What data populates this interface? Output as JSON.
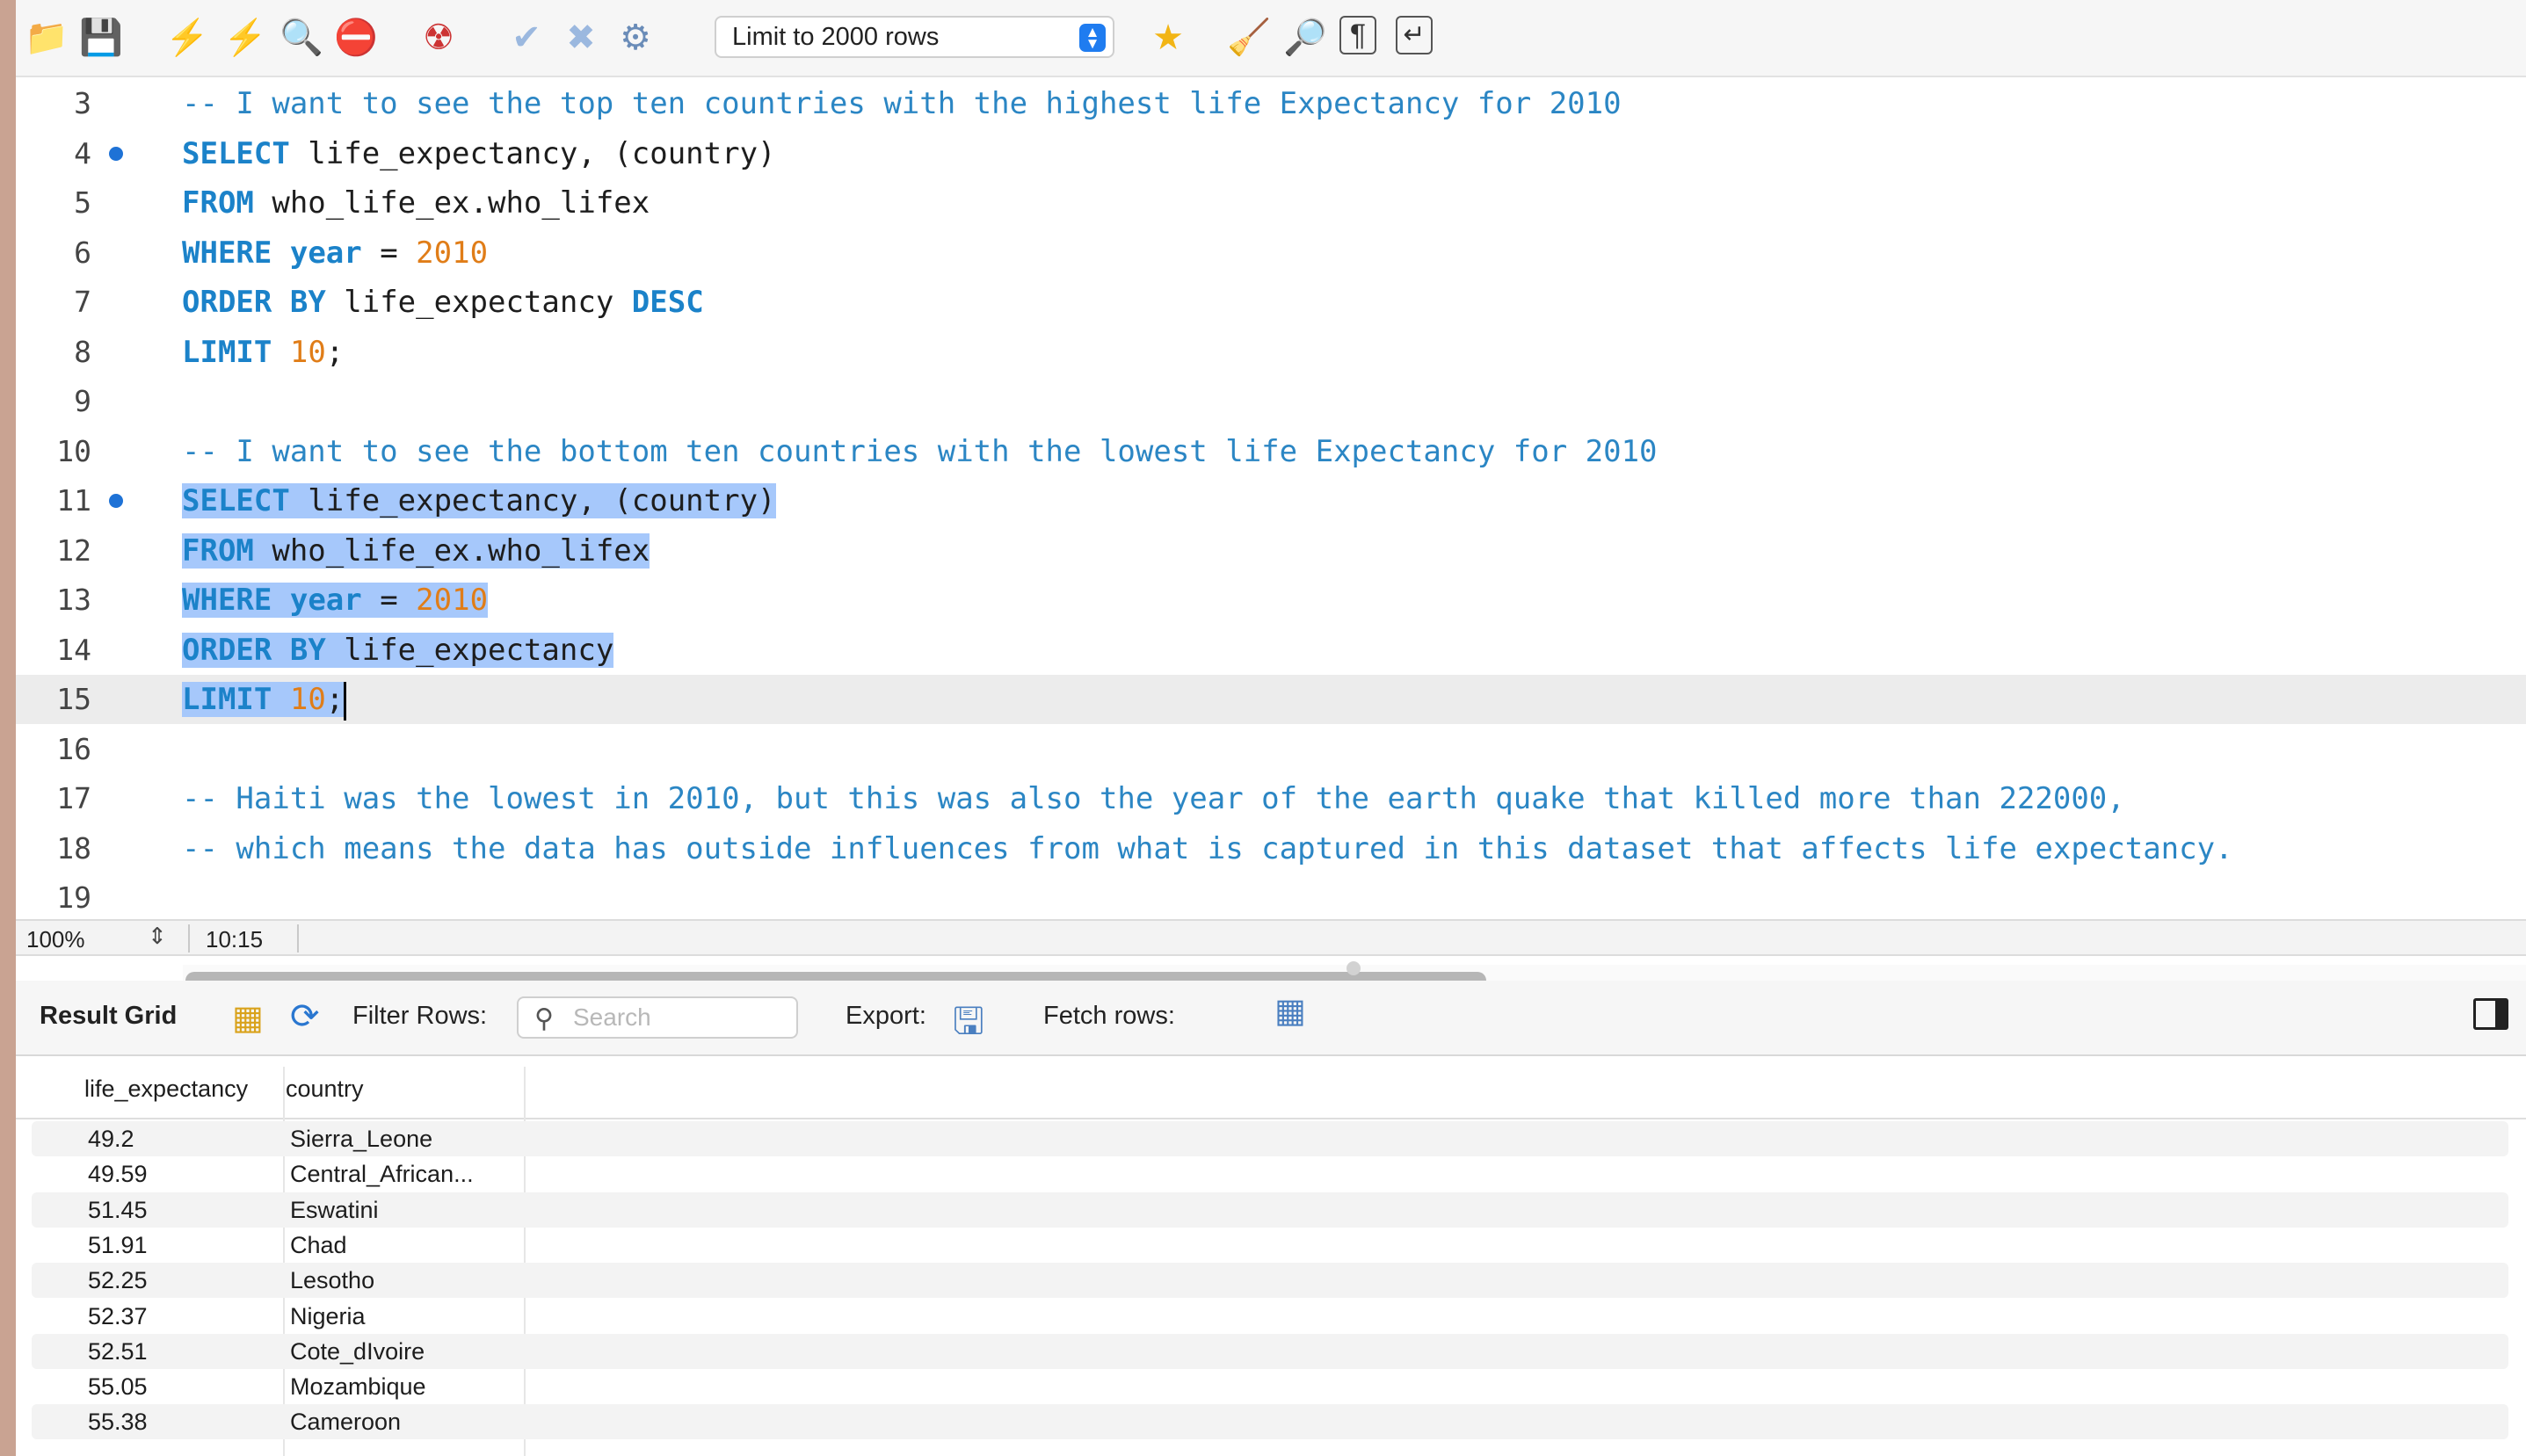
{
  "toolbar": {
    "icons": [
      "open-folder-icon",
      "save-icon",
      "execute-lightning-icon",
      "execute-current-lightning-icon",
      "explain-magnifier-icon",
      "stop-icon",
      "toggle-error-icon",
      "commit-check-icon",
      "rollback-x-icon",
      "autocommit-icon",
      "bookmark-star-icon",
      "beautify-broom-icon",
      "find-magnifier-icon",
      "invisible-chars-pilcrow-icon",
      "wrap-lines-icon"
    ],
    "limit_label": "Limit to 2000 rows"
  },
  "editor": {
    "lines": [
      {
        "n": "3",
        "text": "-- I want to see the top ten countries with the highest life Expectancy for 2010"
      },
      {
        "n": "4",
        "breakpoint": true,
        "text": "SELECT life_expectancy, (country)"
      },
      {
        "n": "5",
        "text": "FROM who_life_ex.who_lifex"
      },
      {
        "n": "6",
        "text": "WHERE year = 2010"
      },
      {
        "n": "7",
        "text": "ORDER BY life_expectancy DESC"
      },
      {
        "n": "8",
        "text": "LIMIT 10;"
      },
      {
        "n": "9",
        "text": ""
      },
      {
        "n": "10",
        "text": "-- I want to see the bottom ten countries with the lowest life Expectancy for 2010"
      },
      {
        "n": "11",
        "breakpoint": true,
        "selected": true,
        "text": "SELECT life_expectancy, (country)"
      },
      {
        "n": "12",
        "selected": true,
        "text": "FROM who_life_ex.who_lifex"
      },
      {
        "n": "13",
        "selected": true,
        "text": "WHERE year = 2010"
      },
      {
        "n": "14",
        "selected": true,
        "text": "ORDER BY life_expectancy"
      },
      {
        "n": "15",
        "selected": true,
        "current": true,
        "text": "LIMIT 10;"
      },
      {
        "n": "16",
        "text": ""
      },
      {
        "n": "17",
        "text": "-- Haiti was the lowest in 2010, but this was also the year of the earth quake that killed more than 222000,"
      },
      {
        "n": "18",
        "text": "-- which means the data has outside influences from what is captured in this dataset that affects life expectancy."
      },
      {
        "n": "19",
        "text": ""
      }
    ],
    "colors": {
      "keyword": "#1b82c9",
      "number": "#e07d18",
      "comment": "#2b86c4",
      "selection": "#a6c8fb"
    }
  },
  "statusbar": {
    "zoom": "100%",
    "cursor_position": "10:15"
  },
  "results": {
    "title": "Result Grid",
    "filter_label": "Filter Rows:",
    "search_placeholder": "Search",
    "export_label": "Export:",
    "fetch_label": "Fetch rows:",
    "columns": [
      "life_expectancy",
      "country"
    ],
    "rows": [
      [
        "49.2",
        "Sierra_Leone"
      ],
      [
        "49.59",
        "Central_African..."
      ],
      [
        "51.45",
        "Eswatini"
      ],
      [
        "51.91",
        "Chad"
      ],
      [
        "52.25",
        "Lesotho"
      ],
      [
        "52.37",
        "Nigeria"
      ],
      [
        "52.51",
        "Cote_dIvoire"
      ],
      [
        "55.05",
        "Mozambique"
      ],
      [
        "55.38",
        "Cameroon"
      ]
    ]
  }
}
